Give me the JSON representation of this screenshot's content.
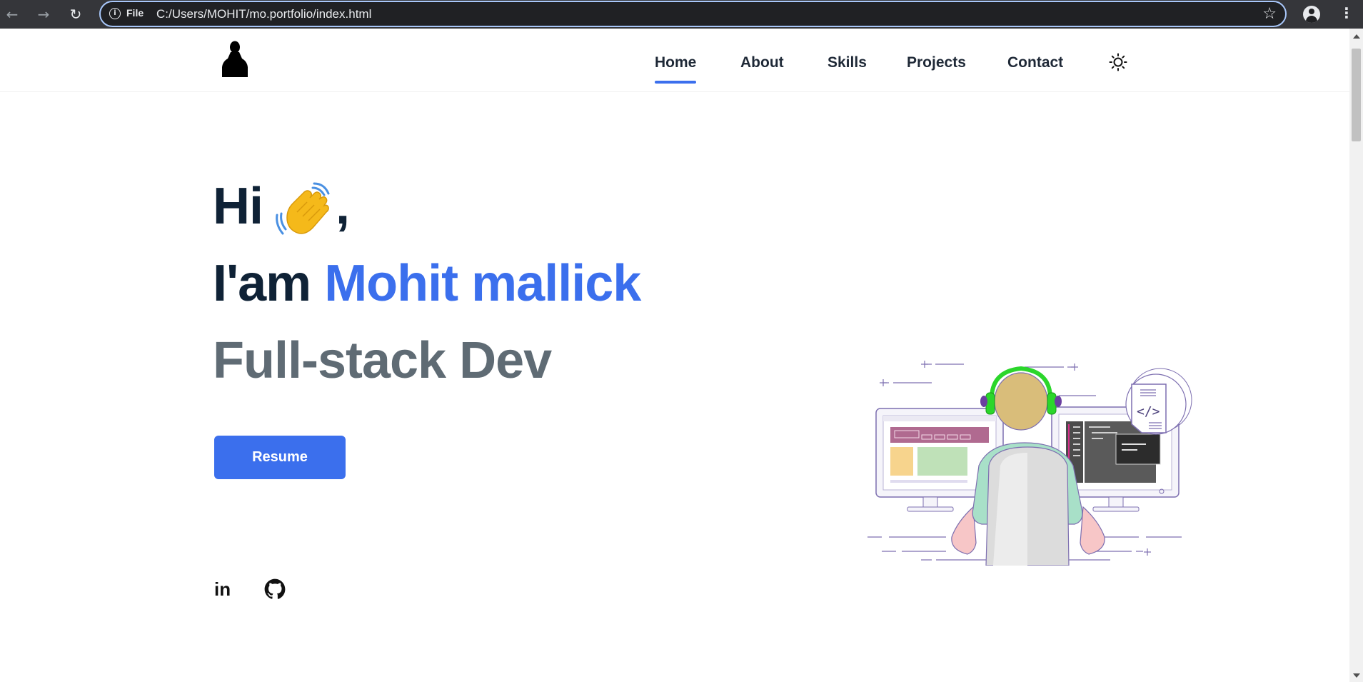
{
  "browser": {
    "file_label": "File",
    "url": "C:/Users/MOHIT/mo.portfolio/index.html",
    "icons": [
      "back-icon",
      "forward-icon",
      "reload-icon",
      "info-icon",
      "star-icon",
      "profile-icon",
      "menu-icon"
    ]
  },
  "nav": {
    "items": [
      {
        "label": "Home",
        "active": true
      },
      {
        "label": "About",
        "active": false
      },
      {
        "label": "Skills",
        "active": false
      },
      {
        "label": "Projects",
        "active": false
      },
      {
        "label": "Contact",
        "active": false
      }
    ],
    "theme_icon": "sun-icon"
  },
  "hero": {
    "greeting": "Hi",
    "greeting_suffix": ",",
    "intro": "I'am",
    "name": "Mohit mallick",
    "role": "Full-stack Dev",
    "resume_label": "Resume",
    "social": [
      {
        "name": "linkedin",
        "text": "in"
      },
      {
        "name": "github",
        "icon": "github-icon"
      }
    ]
  },
  "colors": {
    "accent": "#3b6fed",
    "heading": "#0f2236",
    "role": "#5f6b74",
    "chrome": "#35363a"
  }
}
